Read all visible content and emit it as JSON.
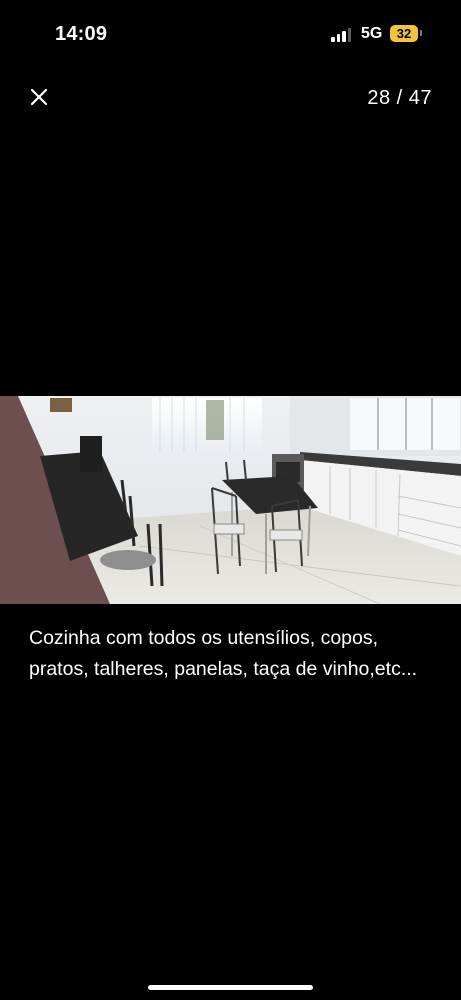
{
  "status_bar": {
    "time": "14:09",
    "network": "5G",
    "battery": "32",
    "battery_color": "#f5c33b",
    "signal_icon": "signal-bars-icon"
  },
  "header": {
    "close_icon": "close-icon",
    "counter": "28 / 47"
  },
  "photo": {
    "subject": "kitchen-photo"
  },
  "caption": "Cozinha com todos os utensílios, copos, pratos, talheres, panelas, taça de vinho,etc..."
}
